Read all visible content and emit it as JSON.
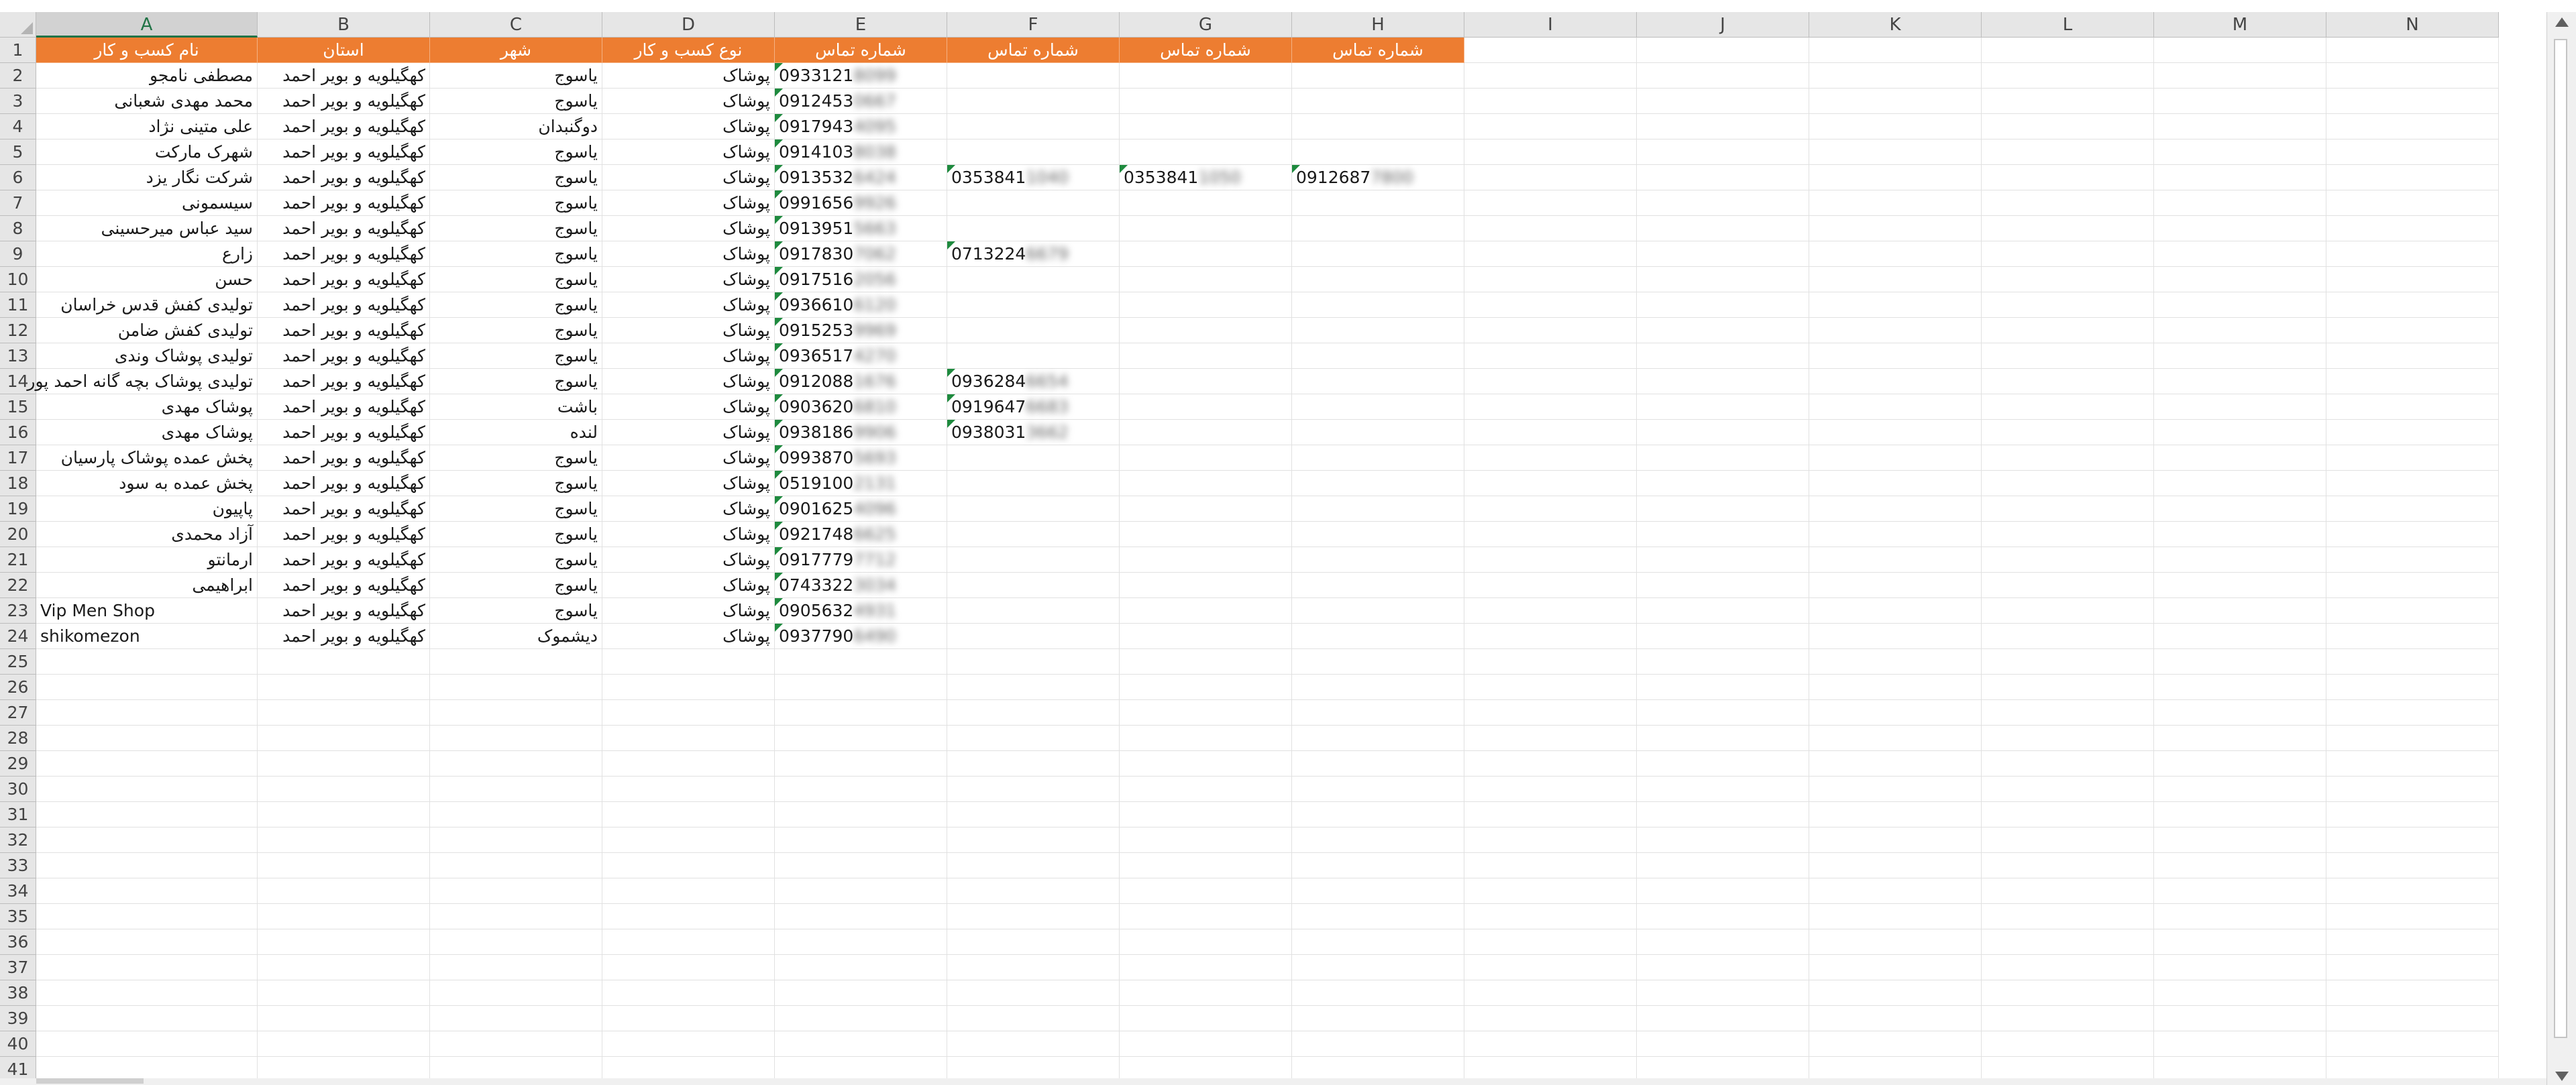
{
  "columns": [
    "A",
    "B",
    "C",
    "D",
    "E",
    "F",
    "G",
    "H",
    "I",
    "J",
    "K",
    "L",
    "M",
    "N"
  ],
  "row_numbers": [
    "1",
    "2",
    "3",
    "4",
    "5",
    "6",
    "7",
    "8",
    "9",
    "10",
    "11",
    "12",
    "13",
    "14",
    "15",
    "16",
    "17",
    "18",
    "19",
    "20",
    "21",
    "22",
    "23",
    "24",
    "25",
    "26",
    "27",
    "28",
    "29",
    "30",
    "31",
    "32",
    "33",
    "34",
    "35",
    "36",
    "37",
    "38",
    "39",
    "40",
    "41"
  ],
  "headers": [
    "نام کسب و کار",
    "استان",
    "شهر",
    "نوع کسب و کار",
    "شماره تماس",
    "شماره تماس",
    "شماره تماس",
    "شماره تماس"
  ],
  "colors": {
    "header_fill": "#ed7d31",
    "header_text": "#ffffff",
    "selection_accent": "#217346",
    "comment_marker": "#1e8a3e"
  },
  "rows": [
    {
      "name": "مصطفی نامجو",
      "province": "کهگیلویه و بویر احمد",
      "city": "یاسوج",
      "type": "پوشاک",
      "phones": [
        {
          "v": "0933121",
          "m": "8099"
        }
      ]
    },
    {
      "name": "محمد مهدی شعبانی",
      "province": "کهگیلویه و بویر احمد",
      "city": "یاسوج",
      "type": "پوشاک",
      "phones": [
        {
          "v": "0912453",
          "m": "0667"
        }
      ]
    },
    {
      "name": "علی متینی نژاد",
      "province": "کهگیلویه و بویر احمد",
      "city": "دوگنبدان",
      "type": "پوشاک",
      "phones": [
        {
          "v": "0917943",
          "m": "4095"
        }
      ]
    },
    {
      "name": "شهرک مارکت",
      "province": "کهگیلویه و بویر احمد",
      "city": "یاسوج",
      "type": "پوشاک",
      "phones": [
        {
          "v": "0914103",
          "m": "8038"
        }
      ]
    },
    {
      "name": "شرکت نگار یزد",
      "province": "کهگیلویه و بویر احمد",
      "city": "یاسوج",
      "type": "پوشاک",
      "phones": [
        {
          "v": "0913532",
          "m": "6424"
        },
        {
          "v": "0353841",
          "m": "1040"
        },
        {
          "v": "0353841",
          "m": "1050"
        },
        {
          "v": "0912687",
          "m": "7800"
        }
      ]
    },
    {
      "name": "سیسمونی",
      "province": "کهگیلویه و بویر احمد",
      "city": "یاسوج",
      "type": "پوشاک",
      "phones": [
        {
          "v": "0991656",
          "m": "9926"
        }
      ]
    },
    {
      "name": "سید عباس میرحسینی",
      "province": "کهگیلویه و بویر احمد",
      "city": "یاسوج",
      "type": "پوشاک",
      "phones": [
        {
          "v": "0913951",
          "m": "5663"
        }
      ]
    },
    {
      "name": "زارع",
      "province": "کهگیلویه و بویر احمد",
      "city": "یاسوج",
      "type": "پوشاک",
      "phones": [
        {
          "v": "0917830",
          "m": "7062"
        },
        {
          "v": "0713224",
          "m": "6679"
        }
      ]
    },
    {
      "name": "حسن",
      "province": "کهگیلویه و بویر احمد",
      "city": "یاسوج",
      "type": "پوشاک",
      "phones": [
        {
          "v": "0917516",
          "m": "2056"
        }
      ]
    },
    {
      "name": "تولیدی کفش قدس خراسان",
      "province": "کهگیلویه و بویر احمد",
      "city": "یاسوج",
      "type": "پوشاک",
      "phones": [
        {
          "v": "0936610",
          "m": "6120"
        }
      ]
    },
    {
      "name": "تولیدی کفش ضامن",
      "province": "کهگیلویه و بویر احمد",
      "city": "یاسوج",
      "type": "پوشاک",
      "phones": [
        {
          "v": "0915253",
          "m": "9969"
        }
      ]
    },
    {
      "name": "تولیدی پوشاک وندی",
      "province": "کهگیلویه و بویر احمد",
      "city": "یاسوج",
      "type": "پوشاک",
      "phones": [
        {
          "v": "0936517",
          "m": "4270"
        }
      ]
    },
    {
      "name": "تولیدی پوشاک بچه گانه  احمد پور",
      "province": "کهگیلویه و بویر احمد",
      "city": "یاسوج",
      "type": "پوشاک",
      "phones": [
        {
          "v": "0912088",
          "m": "1676"
        },
        {
          "v": "0936284",
          "m": "6654"
        }
      ]
    },
    {
      "name": "پوشاک مهدی",
      "province": "کهگیلویه و بویر احمد",
      "city": "باشت",
      "type": "پوشاک",
      "phones": [
        {
          "v": "0903620",
          "m": "6810"
        },
        {
          "v": "0919647",
          "m": "6683"
        }
      ]
    },
    {
      "name": "پوشاک مهدی",
      "province": "کهگیلویه و بویر احمد",
      "city": "لنده",
      "type": "پوشاک",
      "phones": [
        {
          "v": "0938186",
          "m": "9906"
        },
        {
          "v": "0938031",
          "m": "3662"
        }
      ]
    },
    {
      "name": "پخش عمده پوشاک پارسیان",
      "province": "کهگیلویه و بویر احمد",
      "city": "یاسوج",
      "type": "پوشاک",
      "phones": [
        {
          "v": "0993870",
          "m": "5693"
        }
      ]
    },
    {
      "name": "پخش عمده به سود",
      "province": "کهگیلویه و بویر احمد",
      "city": "یاسوج",
      "type": "پوشاک",
      "phones": [
        {
          "v": "0519100",
          "m": "2131"
        }
      ]
    },
    {
      "name": "پاپیون",
      "province": "کهگیلویه و بویر احمد",
      "city": "یاسوج",
      "type": "پوشاک",
      "phones": [
        {
          "v": "0901625",
          "m": "4096"
        }
      ]
    },
    {
      "name": "آزاد محمدی",
      "province": "کهگیلویه و بویر احمد",
      "city": "یاسوج",
      "type": "پوشاک",
      "phones": [
        {
          "v": "0921748",
          "m": "6625"
        }
      ]
    },
    {
      "name": "ارمانتو",
      "province": "کهگیلویه و بویر احمد",
      "city": "یاسوج",
      "type": "پوشاک",
      "phones": [
        {
          "v": "0917779",
          "m": "7712"
        }
      ]
    },
    {
      "name": "ابراهیمی",
      "province": "کهگیلویه و بویر احمد",
      "city": "یاسوج",
      "type": "پوشاک",
      "phones": [
        {
          "v": "0743322",
          "m": "3034"
        }
      ]
    },
    {
      "name": "Vip Men Shop",
      "province": "کهگیلویه و بویر احمد",
      "city": "یاسوج",
      "type": "پوشاک",
      "phones": [
        {
          "v": "0905632",
          "m": "4931"
        }
      ]
    },
    {
      "name": "shikomezon",
      "province": "کهگیلویه و بویر احمد",
      "city": "دیشموک",
      "type": "پوشاک",
      "phones": [
        {
          "v": "0937790",
          "m": "6490"
        }
      ]
    }
  ]
}
